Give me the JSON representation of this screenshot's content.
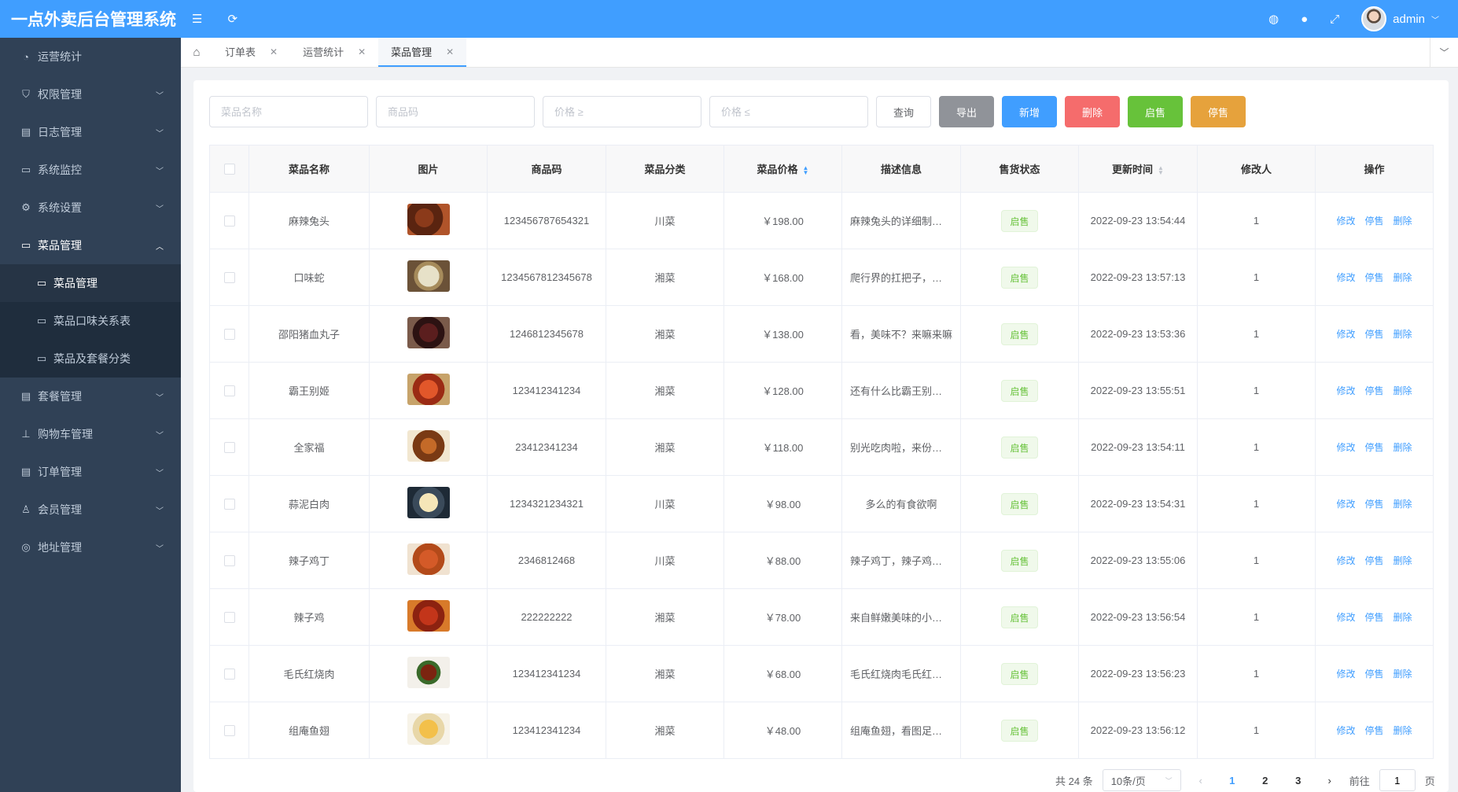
{
  "app": {
    "title": "一点外卖后台管理系统",
    "user": "admin",
    "colors": {
      "primary": "#409eff",
      "sidebar": "#304156",
      "success": "#67c23a",
      "danger": "#f56c6c",
      "warning": "#e6a23c",
      "info": "#909399"
    }
  },
  "header": {
    "icons": {
      "menu_toggle": "hamburger-icon",
      "refresh": "refresh-icon",
      "language": "globe-icon",
      "github": "github-icon",
      "fullscreen": "fullscreen-icon",
      "dropdown": "chevron-down-icon"
    }
  },
  "sidebar": {
    "items": [
      {
        "label": "运营统计",
        "icon": "dashboard-icon",
        "has_arrow": false
      },
      {
        "label": "权限管理",
        "icon": "shield-icon",
        "has_arrow": true
      },
      {
        "label": "日志管理",
        "icon": "log-icon",
        "has_arrow": true
      },
      {
        "label": "系统监控",
        "icon": "monitor-icon",
        "has_arrow": true
      },
      {
        "label": "系统设置",
        "icon": "gear-icon",
        "has_arrow": true
      },
      {
        "label": "菜品管理",
        "icon": "folder-icon",
        "has_arrow": true,
        "open": true,
        "children": [
          {
            "label": "菜品管理",
            "icon": "monitor-icon",
            "active": true
          },
          {
            "label": "菜品口味关系表",
            "icon": "monitor-icon"
          },
          {
            "label": "菜品及套餐分类",
            "icon": "monitor-icon"
          }
        ]
      },
      {
        "label": "套餐管理",
        "icon": "list-icon",
        "has_arrow": true
      },
      {
        "label": "购物车管理",
        "icon": "tree-icon",
        "has_arrow": true
      },
      {
        "label": "订单管理",
        "icon": "list-icon",
        "has_arrow": true
      },
      {
        "label": "会员管理",
        "icon": "user-icon",
        "has_arrow": true
      },
      {
        "label": "地址管理",
        "icon": "location-icon",
        "has_arrow": true
      }
    ]
  },
  "tags": [
    {
      "label": "订单表",
      "active": false
    },
    {
      "label": "运营统计",
      "active": false
    },
    {
      "label": "菜品管理",
      "active": true
    }
  ],
  "filters": {
    "name_placeholder": "菜品名称",
    "code_placeholder": "商品码",
    "price_min_placeholder": "价格 ≥",
    "price_max_placeholder": "价格 ≤",
    "query_label": "查询",
    "export_label": "导出",
    "add_label": "新增",
    "delete_label": "删除",
    "on_sale_label": "启售",
    "off_sale_label": "停售"
  },
  "table": {
    "columns": [
      "菜品名称",
      "图片",
      "商品码",
      "菜品分类",
      "菜品价格",
      "描述信息",
      "售货状态",
      "更新时间",
      "修改人",
      "操作"
    ],
    "row_actions": [
      "修改",
      "停售",
      "删除"
    ],
    "rows": [
      {
        "name": "麻辣兔头",
        "image": "dish-image",
        "code": "123456787654321",
        "category": "川菜",
        "price": "￥198.00",
        "desc": "麻辣兔头的详细制作方法",
        "status": "启售",
        "time": "2022-09-23 13:54:44",
        "editor": "1"
      },
      {
        "name": "口味蛇",
        "image": "dish-image",
        "code": "1234567812345678",
        "category": "湘菜",
        "price": "￥168.00",
        "desc": "爬行界的扛把子，东兴-口味蛇",
        "status": "启售",
        "time": "2022-09-23 13:57:13",
        "editor": "1"
      },
      {
        "name": "邵阳猪血丸子",
        "image": "dish-image",
        "code": "1246812345678",
        "category": "湘菜",
        "price": "￥138.00",
        "desc": "看，美味不？来嘛来嘛",
        "status": "启售",
        "time": "2022-09-23 13:53:36",
        "editor": "1"
      },
      {
        "name": "霸王别姬",
        "image": "dish-image",
        "code": "123412341234",
        "category": "湘菜",
        "price": "￥128.00",
        "desc": "还有什么比霸王别姬更美味的呢",
        "status": "启售",
        "time": "2022-09-23 13:55:51",
        "editor": "1"
      },
      {
        "name": "全家福",
        "image": "dish-image",
        "code": "23412341234",
        "category": "湘菜",
        "price": "￥118.00",
        "desc": "别光吃肉啦，来份全家福吧",
        "status": "启售",
        "time": "2022-09-23 13:54:11",
        "editor": "1"
      },
      {
        "name": "蒜泥白肉",
        "image": "dish-image",
        "code": "1234321234321",
        "category": "川菜",
        "price": "￥98.00",
        "desc": "多么的有食欲啊",
        "status": "启售",
        "time": "2022-09-23 13:54:31",
        "editor": "1"
      },
      {
        "name": "辣子鸡丁",
        "image": "dish-image",
        "code": "2346812468",
        "category": "川菜",
        "price": "￥88.00",
        "desc": "辣子鸡丁，辣子鸡丁，永远的魂",
        "status": "启售",
        "time": "2022-09-23 13:55:06",
        "editor": "1"
      },
      {
        "name": "辣子鸡",
        "image": "dish-image",
        "code": "222222222",
        "category": "湘菜",
        "price": "￥78.00",
        "desc": "来自鲜嫩美味的小鸡，值得一尝",
        "status": "启售",
        "time": "2022-09-23 13:56:54",
        "editor": "1"
      },
      {
        "name": "毛氏红烧肉",
        "image": "dish-image",
        "code": "123412341234",
        "category": "湘菜",
        "price": "￥68.00",
        "desc": "毛氏红烧肉毛氏红烧肉，确定不来一份？",
        "status": "启售",
        "time": "2022-09-23 13:56:23",
        "editor": "1"
      },
      {
        "name": "组庵鱼翅",
        "image": "dish-image",
        "code": "123412341234",
        "category": "湘菜",
        "price": "￥48.00",
        "desc": "组庵鱼翅，看图足以表明好吃程度",
        "status": "启售",
        "time": "2022-09-23 13:56:12",
        "editor": "1"
      }
    ]
  },
  "pagination": {
    "total": "共 24 条",
    "page_size": "10条/页",
    "pages": [
      "1",
      "2",
      "3"
    ],
    "current": "1",
    "goto_prefix": "前往",
    "goto_value": "1",
    "goto_suffix": "页"
  }
}
